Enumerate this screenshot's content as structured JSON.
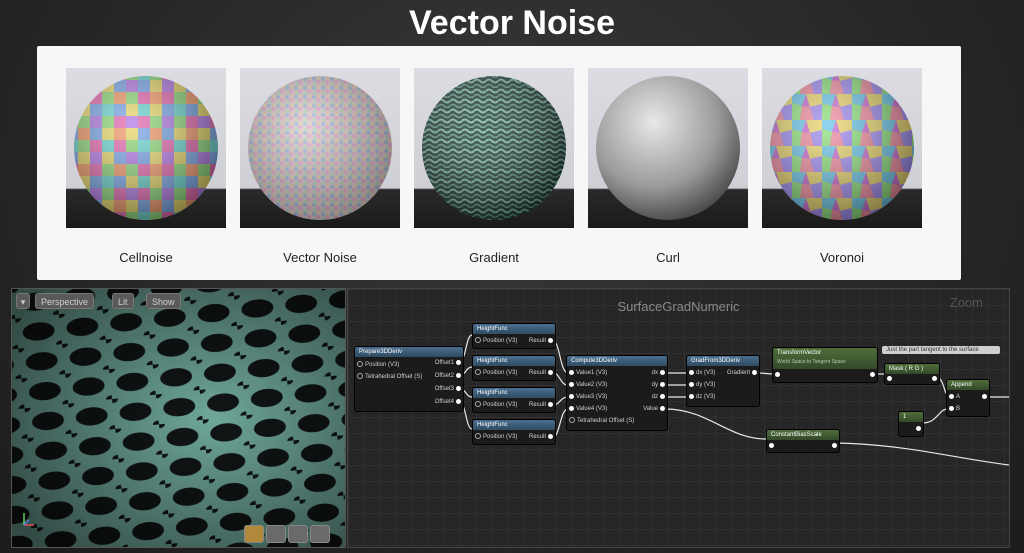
{
  "slide": {
    "title": "Vector Noise"
  },
  "swatches": [
    {
      "label": "Cellnoise",
      "style": "cells"
    },
    {
      "label": "Vector Noise",
      "style": "speckle"
    },
    {
      "label": "Gradient",
      "style": "worm"
    },
    {
      "label": "Curl",
      "style": "grey"
    },
    {
      "label": "Voronoi",
      "style": "voronoi"
    }
  ],
  "viewport": {
    "perspective_label": "Perspective",
    "lit_label": "Lit",
    "show_label": "Show"
  },
  "graph": {
    "title": "SurfaceGradNumeric",
    "zoom_label": "Zoom",
    "nodes": {
      "prepare": {
        "title": "Prepare3DDeriv",
        "in1": "Position (V3)",
        "in2": "Tetrahedral Offset (S)",
        "out1": "Offset1",
        "out2": "Offset2",
        "out3": "Offset3",
        "out4": "Offset4"
      },
      "height": {
        "title": "HeightFunc",
        "in": "Position (V3)",
        "out": "Result"
      },
      "compute": {
        "title": "Compute3DDeriv",
        "in1": "Value1 (V3)",
        "in2": "Value2 (V3)",
        "in3": "Value3 (V3)",
        "in4": "Value4 (V3)",
        "in5": "Tetrahedral Offset (S)",
        "out1": "dx",
        "out2": "dy",
        "out3": "dz",
        "out4": "Value"
      },
      "grad": {
        "title": "GradFrom3DDeriv",
        "in1": "dx (V3)",
        "in2": "dy (V3)",
        "in3": "dz (V3)",
        "out": "Gradient"
      },
      "transform": {
        "title": "TransformVector",
        "subtitle": "World Space to Tangent Space"
      },
      "comment": {
        "text": "Just the part tangent to the surface"
      },
      "mask": {
        "title": "Mask ( R G )"
      },
      "append": {
        "title": "Append",
        "a": "A",
        "b": "B"
      },
      "constant": {
        "value": "1"
      },
      "bias": {
        "title": "ConstantBiasScale"
      }
    }
  },
  "colors": {
    "panel_bg": "#f7f7f7",
    "graph_bg": "#262626",
    "node_head": "#3d5c78",
    "node_head_green": "#425c31"
  }
}
